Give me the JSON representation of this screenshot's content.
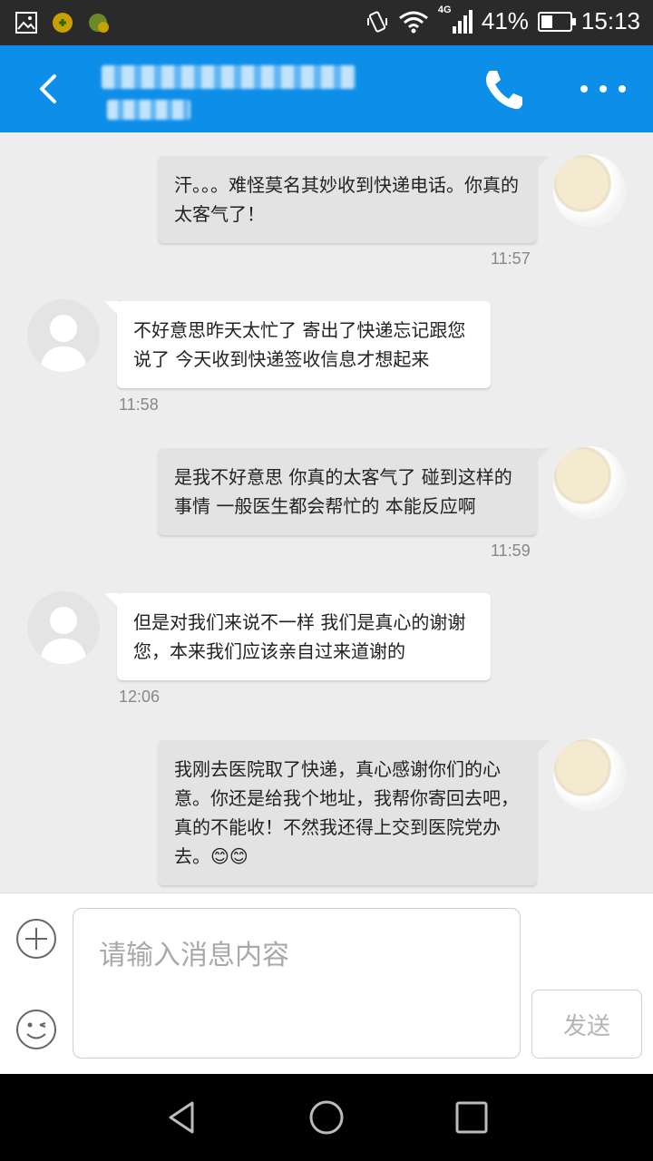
{
  "status_bar": {
    "network": "4G",
    "battery_percent": "41%",
    "battery_level": 0.41,
    "time": "15:13",
    "icons": [
      "gallery-icon",
      "app-badge-icon",
      "app-badge-icon-2",
      "vibrate-icon",
      "wifi-icon",
      "signal-icon",
      "battery-icon"
    ]
  },
  "header": {
    "icons": [
      "back-icon",
      "phone-icon",
      "more-icon"
    ],
    "accent": "#0d8ee9"
  },
  "messages": [
    {
      "side": "out",
      "text": "汗。。。难怪莫名其妙收到快递电话。你真的太客气了！",
      "time": "11:57"
    },
    {
      "side": "in",
      "text": "不好意思昨天太忙了 寄出了快递忘记跟您说了 今天收到快递签收信息才想起来",
      "time": "11:58"
    },
    {
      "side": "out",
      "text": "是我不好意思 你真的太客气了 碰到这样的事情 一般医生都会帮忙的 本能反应啊",
      "time": "11:59"
    },
    {
      "side": "in",
      "text": "但是对我们来说不一样 我们是真心的谢谢您，本来我们应该亲自过来道谢的",
      "time": "12:06"
    },
    {
      "side": "out",
      "text": "我刚去医院取了快递，真心感谢你们的心意。你还是给我个地址，我帮你寄回去吧，真的不能收！不然我还得上交到医院党办去。😊😊",
      "time": ""
    }
  ],
  "input": {
    "placeholder": "请输入消息内容",
    "value": "",
    "send_label": "发送",
    "icons": [
      "add-icon",
      "emoji-icon"
    ]
  },
  "nav": {
    "icons": [
      "back-triangle-icon",
      "home-circle-icon",
      "recents-square-icon"
    ]
  }
}
